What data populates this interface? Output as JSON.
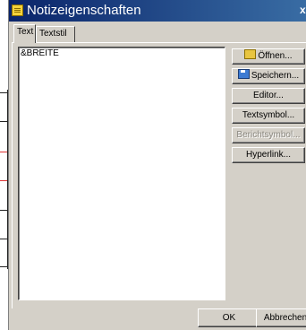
{
  "window": {
    "title": "Notizeigenschaften",
    "close_label": "x"
  },
  "tabs": [
    {
      "label": "Text"
    },
    {
      "label": "Textstil"
    }
  ],
  "editor": {
    "content": "&BREITE"
  },
  "side_buttons": [
    {
      "label": "Öffnen...",
      "icon": "folder-icon",
      "enabled": true
    },
    {
      "label": "Speichern...",
      "icon": "floppy-disk-icon",
      "enabled": true
    },
    {
      "label": "Editor...",
      "enabled": true
    },
    {
      "label": "Textsymbol...",
      "enabled": true
    },
    {
      "label": "Berichtsymbol...",
      "enabled": false
    },
    {
      "label": "Hyperlink...",
      "enabled": true
    }
  ],
  "footer": {
    "ok_label": "OK",
    "cancel_label": "Abbrechen"
  }
}
